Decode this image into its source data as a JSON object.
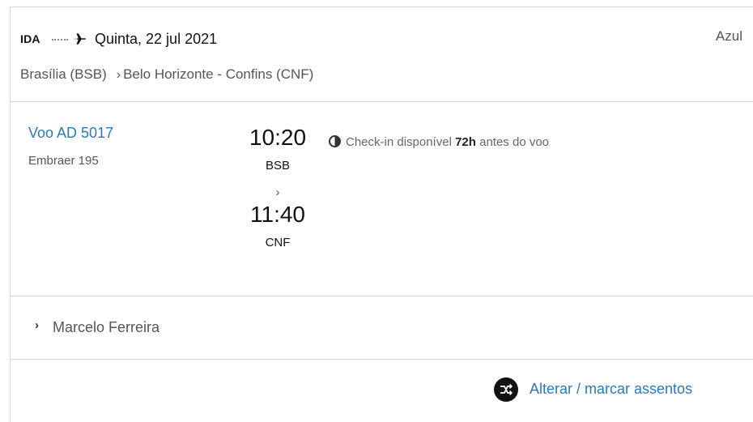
{
  "header": {
    "direction": "IDA",
    "date": "Quinta, 22 jul 2021",
    "airline": "Azul",
    "origin": "Brasília (BSB)",
    "destination": "Belo Horizonte - Confins (CNF)"
  },
  "flight": {
    "number": "Voo AD 5017",
    "aircraft": "Embraer 195",
    "departure_time": "10:20",
    "departure_airport": "BSB",
    "arrival_time": "11:40",
    "arrival_airport": "CNF",
    "checkin_prefix": "Check-in disponível",
    "checkin_hours": "72h",
    "checkin_suffix": "antes do voo"
  },
  "passenger": {
    "name": "Marcelo Ferreira"
  },
  "seats": {
    "label": "Alterar / marcar assentos"
  },
  "colors": {
    "link": "#2a7ab5",
    "border": "#d8d8d8"
  },
  "icons": [
    "plane-icon",
    "clock-icon",
    "chevron-right-icon",
    "seat-change-icon"
  ]
}
